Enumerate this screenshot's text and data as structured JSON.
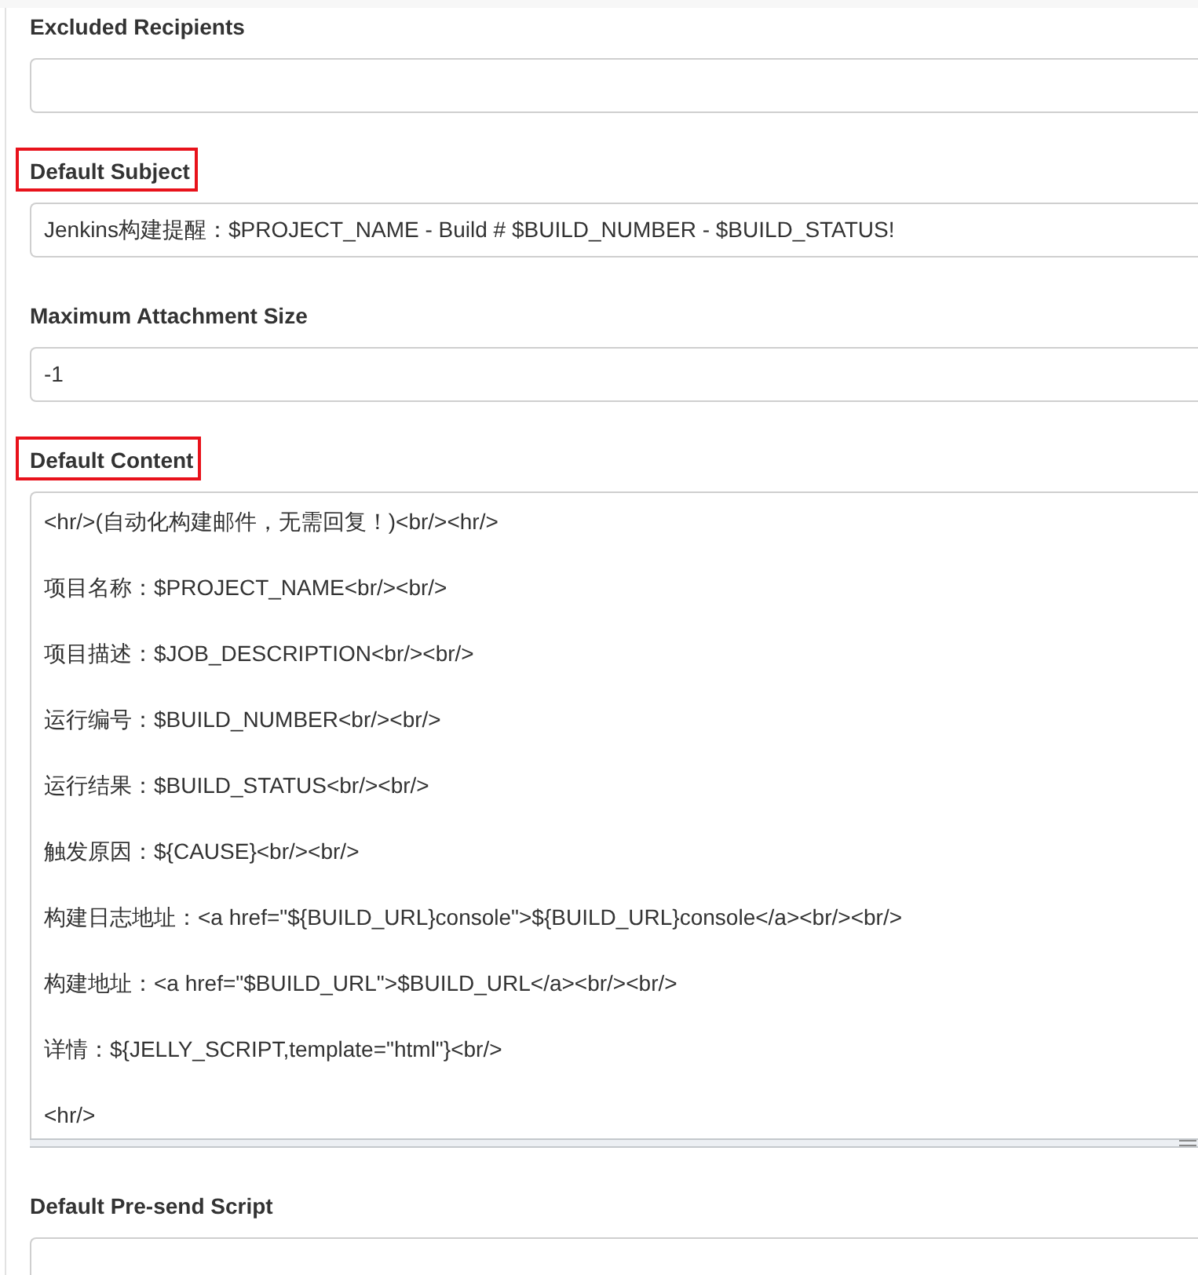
{
  "fields": [
    {
      "label": "Excluded Recipients",
      "kind": "input",
      "highlighted": false
    },
    {
      "label": "Default Subject",
      "kind": "input",
      "highlighted": true,
      "value": "Jenkins构建提醒：$PROJECT_NAME - Build # $BUILD_NUMBER - $BUILD_STATUS!"
    },
    {
      "label": "Maximum Attachment Size",
      "kind": "input",
      "highlighted": false,
      "value": "-1"
    },
    {
      "label": "Default Content",
      "kind": "textarea",
      "highlighted": true,
      "value": "<hr/>(自动化构建邮件，无需回复！)<br/><hr/>\n\n项目名称：$PROJECT_NAME<br/><br/>\n\n项目描述：$JOB_DESCRIPTION<br/><br/>\n\n运行编号：$BUILD_NUMBER<br/><br/>\n\n运行结果：$BUILD_STATUS<br/><br/>\n\n触发原因：${CAUSE}<br/><br/>\n\n构建日志地址：<a href=\"${BUILD_URL}console\">${BUILD_URL}console</a><br/><br/>\n\n构建地址：<a href=\"$BUILD_URL\">$BUILD_URL</a><br/><br/>\n\n详情：${JELLY_SCRIPT,template=\"html\"}<br/>\n\n<hr/>"
    },
    {
      "label": "Default Pre-send Script",
      "kind": "input",
      "highlighted": false
    }
  ]
}
